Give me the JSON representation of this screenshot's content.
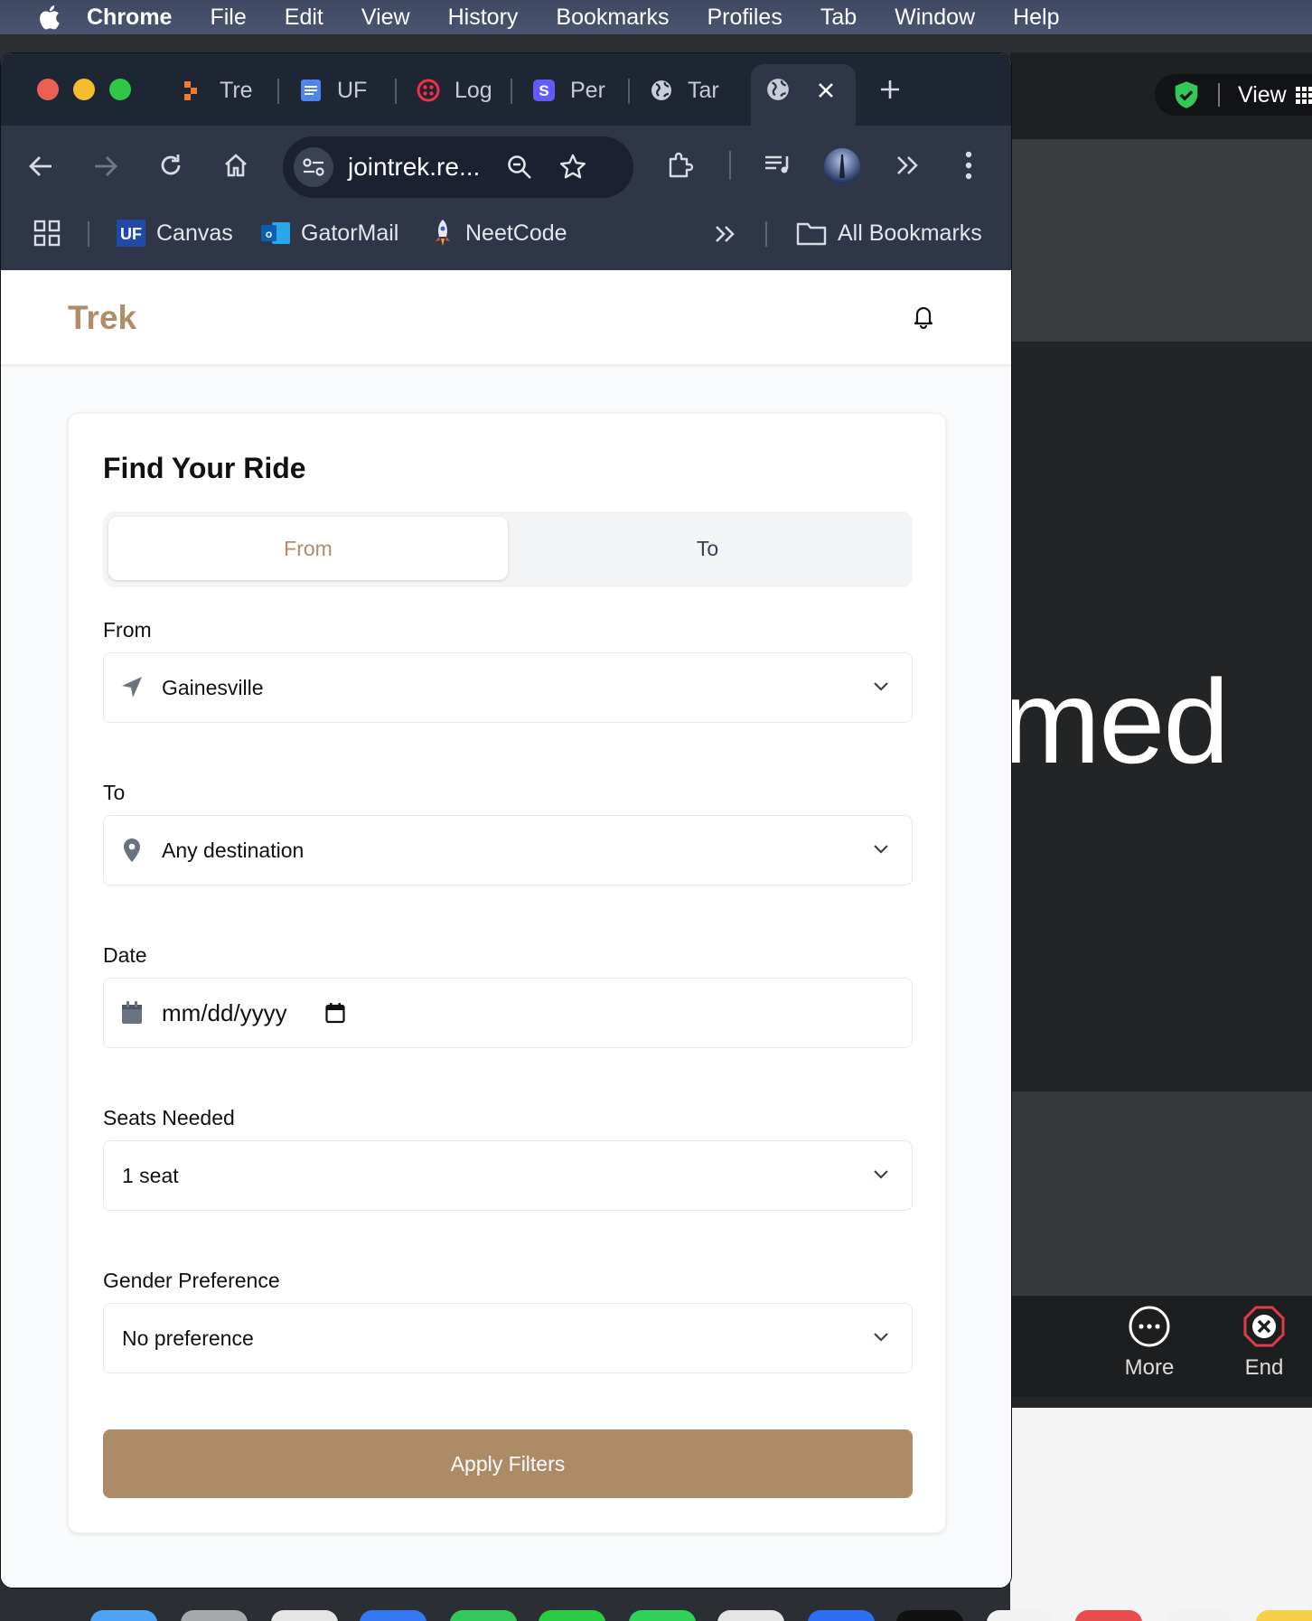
{
  "menubar": {
    "items": [
      "Chrome",
      "File",
      "Edit",
      "View",
      "History",
      "Bookmarks",
      "Profiles",
      "Tab",
      "Window",
      "Help"
    ]
  },
  "background_app": {
    "view_label": "View",
    "big_text": "med",
    "controls": [
      {
        "label": "More",
        "icon": "more-icon"
      },
      {
        "label": "End",
        "icon": "end-icon"
      }
    ]
  },
  "browser": {
    "tabs": [
      {
        "label": "Tre",
        "icon": "trek-favicon"
      },
      {
        "label": "UF",
        "icon": "docs-favicon"
      },
      {
        "label": "Log",
        "icon": "twilio-favicon"
      },
      {
        "label": "Per",
        "icon": "s-favicon"
      },
      {
        "label": "Tar",
        "icon": "globe-favicon"
      }
    ],
    "active_tab_icon": "globe-favicon",
    "address": "jointrek.re...",
    "bookmarks": [
      {
        "label": "Canvas",
        "icon": "uf-icon"
      },
      {
        "label": "GatorMail",
        "icon": "outlook-icon"
      },
      {
        "label": "NeetCode",
        "icon": "rocket-icon"
      }
    ],
    "all_bookmarks": "All Bookmarks",
    "colors": {
      "frame": "#1e2533",
      "toolbar": "#2e3648"
    }
  },
  "app": {
    "brand": "Trek",
    "brand_color": "#b08c68",
    "card_title": "Find Your Ride",
    "segment": {
      "from": "From",
      "to": "To",
      "active": "From"
    },
    "from_label": "From",
    "from_value": "Gainesville",
    "to_label": "To",
    "to_value": "Any destination",
    "date_label": "Date",
    "date_placeholder": "mm/dd/yyyy",
    "seats_label": "Seats Needed",
    "seats_value": "1 seat",
    "gender_label": "Gender Preference",
    "gender_value": "No preference",
    "apply_label": "Apply Filters",
    "apply_color": "#ad8b67"
  }
}
